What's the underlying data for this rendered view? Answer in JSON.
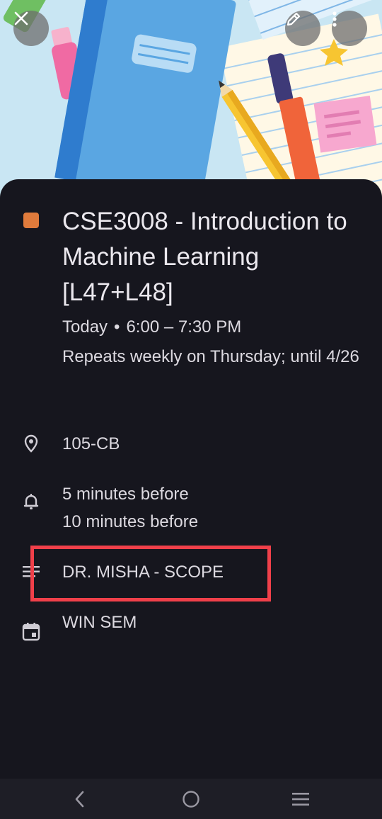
{
  "event": {
    "title": "CSE3008 - Introduction to Machine Learning [L47+L48]",
    "color": "#e07b3c",
    "day": "Today",
    "separator": "•",
    "time": "6:00 – 7:30 PM",
    "recurrence": "Repeats weekly on Thursday; until 4/26",
    "location": "105-CB",
    "reminders": [
      "5 minutes before",
      "10 minutes before"
    ],
    "description": "DR. MISHA - SCOPE",
    "calendar": "WIN SEM"
  },
  "header": {
    "close_icon": "close-icon",
    "edit_icon": "edit-pencil-icon",
    "more_icon": "more-vert-icon"
  },
  "nav": {
    "back_icon": "back-icon",
    "home_icon": "home-icon",
    "recents_icon": "recents-icon"
  },
  "accents": {
    "highlight": "#f0404a",
    "background": "#16161e"
  }
}
